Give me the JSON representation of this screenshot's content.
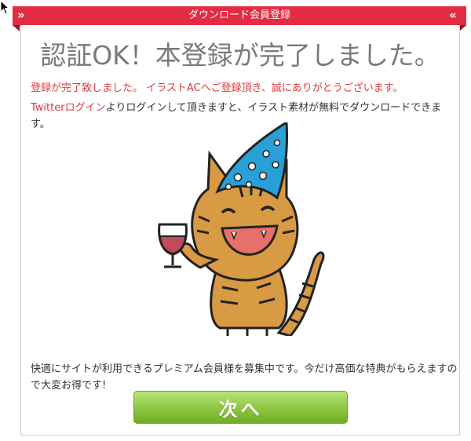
{
  "colors": {
    "ribbon": "#e32b43",
    "headline": "#7a7a7a",
    "red_text": "#e03a3a",
    "button_green": "#8cc63f"
  },
  "header": {
    "title": "ダウンロード会員登録",
    "left_arrow": "»",
    "right_arrow": "«"
  },
  "main": {
    "headline": "認証OK！本登録が完了しました。",
    "thanks_message": "登録が完了致しました。 イラストACへご登録頂き、誠にありがとうございます。",
    "twitter_link": "Twitterログイン",
    "twitter_message": "よりログインして頂きますと、イラスト素材が無料でダウンロードできます。",
    "premium_message": "快適にサイトが利用できるプレミアム会員様を募集中です。今だけ高価な特典がもらえますので大変お得です!"
  },
  "illustration": {
    "icon": "party-cat-with-wine-glass"
  },
  "next_button": {
    "label": "次へ"
  }
}
